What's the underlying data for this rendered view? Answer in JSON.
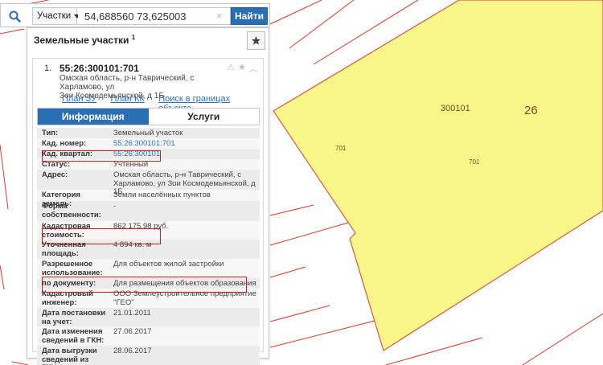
{
  "search": {
    "scope": "Участки",
    "query": "54,688560 73,625003",
    "clear_symbol": "×",
    "submit_label": "Найти"
  },
  "panel": {
    "title": "Земельные участки",
    "title_sup": "1"
  },
  "card": {
    "number": "1.",
    "title": "55:26:300101:701",
    "address_line1": "Омская область, р-н Таврический, с Харламово, ул",
    "address_line2": "Зои Космодемьянской, д 1Б",
    "links": {
      "plan_zu": "План ЗУ →",
      "plan_kk": "План КК →",
      "search_bounds": "Поиск в границах объекта →"
    }
  },
  "tabs": {
    "info": "Информация",
    "services": "Услуги"
  },
  "details": [
    {
      "label": "Тип:",
      "value": "Земельный участок"
    },
    {
      "label": "Кад. номер:",
      "value": "55:26:300101:701"
    },
    {
      "label": "Кад. квартал:",
      "value": "55:26:300101"
    },
    {
      "label": "Статус:",
      "value": "Учтенный"
    },
    {
      "label": "Адрес:",
      "value": "Омская область, р-н Таврический, с Харламово, ул Зои Космодемьянской, д 1Б"
    },
    {
      "label": "Категория земель:",
      "value": "Земли населённых пунктов"
    },
    {
      "label": "Форма собственности:",
      "value": "-"
    },
    {
      "label": "Кадастровая стоимость:",
      "value": "862 175,98 руб."
    },
    {
      "label": "Уточненная площадь:",
      "value": "4 894 кв. м"
    },
    {
      "label": "Разрешенное использование:",
      "value": "Для объектов жилой застройки"
    },
    {
      "label": "по документу:",
      "value": "Для размещения объектов образования"
    },
    {
      "label": "Кадастровый инженер:",
      "value": "ООО Землеустроительное предприятие \"ГЕО\""
    },
    {
      "label": "Дата постановки на учет:",
      "value": "21.01.2011"
    },
    {
      "label": "Дата изменения сведений в ГКН:",
      "value": "27.06.2017"
    },
    {
      "label": "Дата выгрузки сведений из ГКН:",
      "value": "28.06.2017"
    }
  ],
  "map": {
    "block_label": "300101",
    "district_label": "26",
    "parcel_label_left": "701",
    "parcel_label_right": "701",
    "parcel_fill": "#f9f78a",
    "boundary_color": "#e0362a"
  },
  "colors": {
    "accent": "#2a6fb3",
    "highlight": "#c41e1e"
  }
}
